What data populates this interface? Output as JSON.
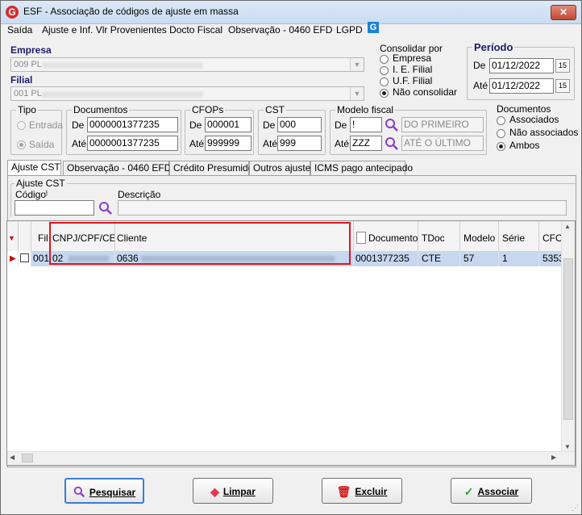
{
  "window": {
    "title": "ESF - Associação de códigos de ajuste em massa",
    "logo": "G",
    "close": "✕"
  },
  "menu": {
    "items": [
      "Saída",
      "Ajuste e Inf. Vlr Provenientes Docto Fiscal",
      "Observação - 0460 EFD",
      "LGPD"
    ],
    "lgpd_icon": "G"
  },
  "empresa": {
    "label": "Empresa",
    "value": "009 PL"
  },
  "filial": {
    "label": "Filial",
    "value": "001 PL"
  },
  "consolidar": {
    "title": "Consolidar por",
    "options": [
      "Empresa",
      "I. E. Filial",
      "U.F. Filial",
      "Não consolidar"
    ],
    "selected": "Não consolidar"
  },
  "periodo": {
    "title": "Período",
    "de_label": "De",
    "de_value": "01/12/2022",
    "ate_label": "Até",
    "ate_value": "01/12/2022",
    "cal_icon": "15"
  },
  "tipo": {
    "title": "Tipo",
    "options": [
      "Entrada",
      "Saída"
    ],
    "selected": "Saída"
  },
  "documentos": {
    "title": "Documentos",
    "de_label": "De",
    "de_value": "0000001377235",
    "ate_label": "Até",
    "ate_value": "0000001377235"
  },
  "cfops": {
    "title": "CFOPs",
    "de_label": "De",
    "de_value": "000001",
    "ate_label": "Até",
    "ate_value": "999999"
  },
  "cst": {
    "title": "CST",
    "de_label": "De",
    "de_value": "000",
    "ate_label": "Até",
    "ate_value": "999"
  },
  "modelo": {
    "title": "Modelo fiscal",
    "de_label": "De",
    "de_value": "!",
    "de_desc": "DO PRIMEIRO",
    "ate_label": "Até",
    "ate_value": "ZZZ",
    "ate_desc": "ATÉ O ÚLTIMO"
  },
  "doc_filter": {
    "title": "Documentos",
    "options": [
      "Associados",
      "Não associados",
      "Ambos"
    ],
    "selected": "Ambos"
  },
  "tabs": [
    "Ajuste CST",
    "Observação - 0460 EFD",
    "Crédito Presumido",
    "Outros ajustes",
    "ICMS pago antecipado"
  ],
  "ajuste": {
    "group_title": "Ajuste CST",
    "codigo_label": "Código",
    "descricao_label": "Descrição"
  },
  "grid": {
    "columns": [
      "Fil",
      "CNPJ/CPF/CEI",
      "Cliente",
      "Documento",
      "TDoc",
      "Modelo",
      "Série",
      "CFOP"
    ],
    "rows": [
      {
        "fil": "001",
        "cnpj": "02",
        "cliente": "0636",
        "documento": "0001377235",
        "tdoc": "CTE",
        "modelo": "57",
        "serie": "1",
        "cfop": "5353"
      }
    ]
  },
  "buttons": {
    "pesquisar": "Pesquisar",
    "limpar": "Limpar",
    "excluir": "Excluir",
    "associar": "Associar"
  },
  "colors": {
    "highlight": "#e0141e",
    "selection": "#c6d7ef",
    "accent": "#3b7bd6"
  }
}
